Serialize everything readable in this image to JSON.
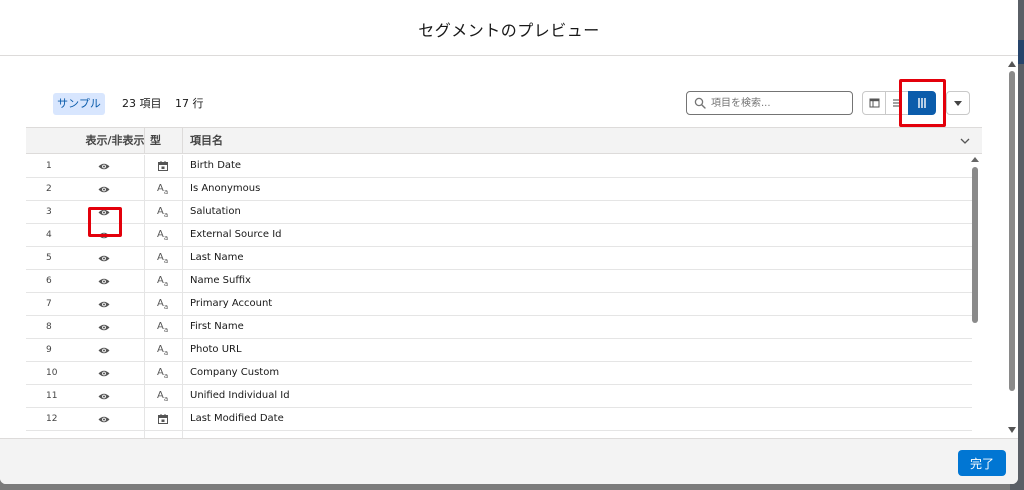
{
  "modal": {
    "title": "セグメントのプレビュー",
    "done_label": "完了"
  },
  "toolbar": {
    "sample_label": "サンプル",
    "field_count": "23 項目",
    "row_count": "17 行",
    "search_placeholder": "項目を検索..."
  },
  "table": {
    "headers": {
      "visibility": "表示/非表示",
      "type": "型",
      "field_name": "項目名"
    },
    "rows": [
      {
        "num": "1",
        "type": "date",
        "name": "Birth Date"
      },
      {
        "num": "2",
        "type": "text",
        "name": "Is Anonymous"
      },
      {
        "num": "3",
        "type": "text",
        "name": "Salutation"
      },
      {
        "num": "4",
        "type": "text",
        "name": "External Source Id"
      },
      {
        "num": "5",
        "type": "text",
        "name": "Last Name"
      },
      {
        "num": "6",
        "type": "text",
        "name": "Name Suffix"
      },
      {
        "num": "7",
        "type": "text",
        "name": "Primary Account"
      },
      {
        "num": "8",
        "type": "text",
        "name": "First Name"
      },
      {
        "num": "9",
        "type": "text",
        "name": "Photo URL"
      },
      {
        "num": "10",
        "type": "text",
        "name": "Company Custom"
      },
      {
        "num": "11",
        "type": "text",
        "name": "Unified Individual Id"
      },
      {
        "num": "12",
        "type": "date",
        "name": "Last Modified Date"
      }
    ]
  },
  "icons": {
    "visibility": "eye-icon",
    "text_type": "text-type-icon",
    "date_type": "calendar-icon",
    "search": "search-icon",
    "table_view": "table-view-icon",
    "list_view": "list-view-icon",
    "column_view": "column-view-icon",
    "menu": "chevron-down-icon"
  },
  "colors": {
    "brand": "#0176d3",
    "selected_view": "#0b5cab",
    "badge_bg": "#d8e6fe",
    "highlight": "#e3000b"
  }
}
